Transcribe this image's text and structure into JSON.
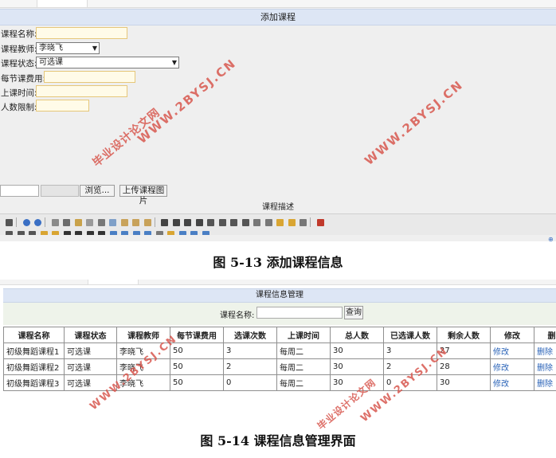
{
  "figure1": {
    "form_title": "添加课程",
    "fields": {
      "course_name": {
        "label": "课程名称:",
        "value": ""
      },
      "teacher": {
        "label": "课程教师:",
        "value": "李晓飞"
      },
      "status": {
        "label": "课程状态:",
        "value": "可选课"
      },
      "fee": {
        "label": "每节课费用:",
        "value": ""
      },
      "time": {
        "label": "上课时间:",
        "value": ""
      },
      "limit": {
        "label": "人数限制:",
        "value": ""
      }
    },
    "upload": {
      "browse_label": "浏览...",
      "upload_label": "上传课程图片"
    },
    "description_label": "课程描述",
    "caption": "图 5-13 添加课程信息"
  },
  "figure2": {
    "title": "课程信息管理",
    "search": {
      "label": "课程名称:",
      "button": "查询",
      "value": ""
    },
    "columns": [
      "课程名称",
      "课程状态",
      "课程教师",
      "每节课费用",
      "选课次数",
      "上课时间",
      "总人数",
      "已选课人数",
      "剩余人数",
      "修改",
      "删除"
    ],
    "rows": [
      [
        "初级舞蹈课程1",
        "可选课",
        "李晓飞",
        "50",
        "3",
        "每周二",
        "30",
        "3",
        "27",
        "修改",
        "删除"
      ],
      [
        "初级舞蹈课程2",
        "可选课",
        "李晓飞",
        "50",
        "2",
        "每周二",
        "30",
        "2",
        "28",
        "修改",
        "删除"
      ],
      [
        "初级舞蹈课程3",
        "可选课",
        "李晓飞",
        "50",
        "0",
        "每周二",
        "30",
        "0",
        "30",
        "修改",
        "删除"
      ]
    ],
    "caption": "图 5-14 课程信息管理界面"
  },
  "watermarks": {
    "site": "WWW.2BYSJ.CN",
    "name": "毕业设计论文网",
    "color": "#d8584f"
  }
}
